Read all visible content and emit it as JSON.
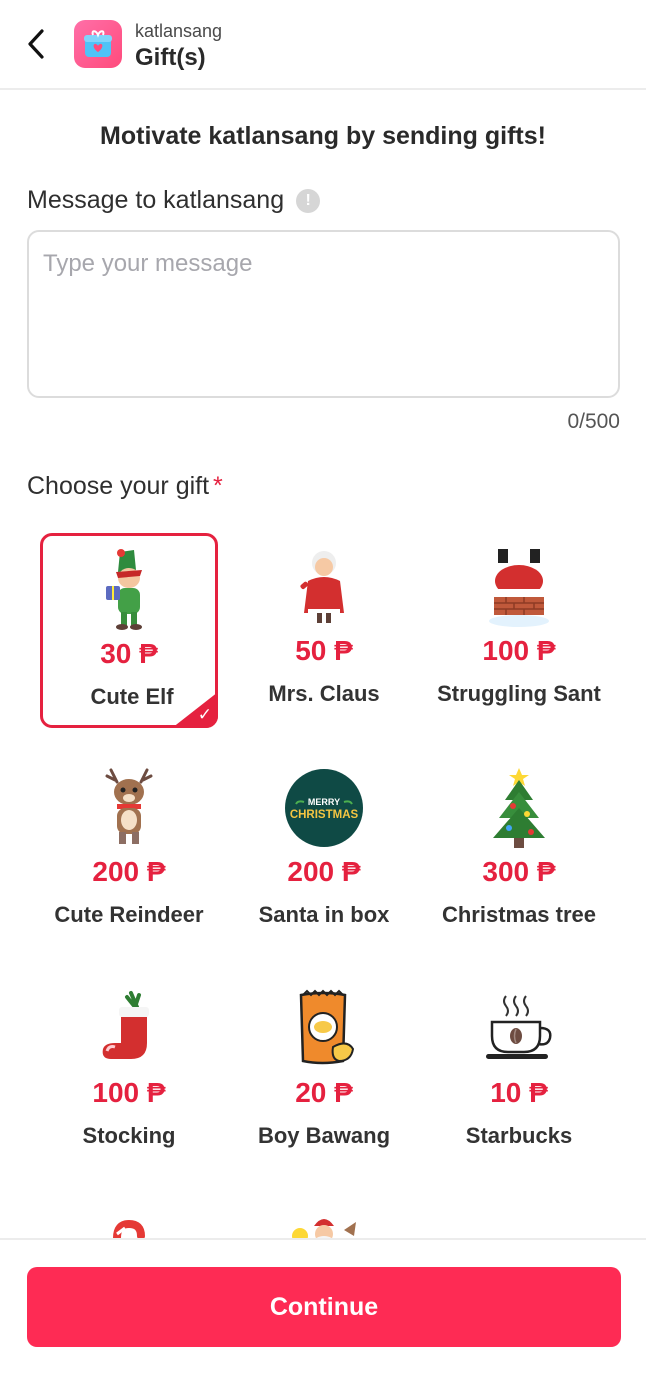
{
  "header": {
    "subtitle": "katlansang",
    "title": "Gift(s)"
  },
  "headline": "Motivate katlansang by sending gifts!",
  "message": {
    "label": "Message to katlansang",
    "placeholder": "Type your message",
    "value": "",
    "counter": "0/500"
  },
  "choose": {
    "label": "Choose your gift",
    "required_mark": "*"
  },
  "gifts": [
    {
      "price": "30 ₱",
      "name": "Cute Elf",
      "icon": "elf-icon",
      "selected": true
    },
    {
      "price": "50 ₱",
      "name": "Mrs. Claus",
      "icon": "mrs-claus-icon",
      "selected": false
    },
    {
      "price": "100 ₱",
      "name": "Struggling Sant",
      "icon": "struggling-santa-icon",
      "selected": false
    },
    {
      "price": "200 ₱",
      "name": "Cute Reindeer",
      "icon": "reindeer-icon",
      "selected": false
    },
    {
      "price": "200 ₱",
      "name": "Santa in box",
      "icon": "merry-christmas-badge-icon",
      "badge_text": "MERRY CHRISTMAS",
      "selected": false
    },
    {
      "price": "300 ₱",
      "name": "Christmas tree",
      "icon": "christmas-tree-icon",
      "selected": false
    },
    {
      "price": "100 ₱",
      "name": "Stocking",
      "icon": "stocking-icon",
      "selected": false
    },
    {
      "price": "20 ₱",
      "name": "Boy Bawang",
      "icon": "snack-bag-icon",
      "selected": false
    },
    {
      "price": "10 ₱",
      "name": "Starbucks",
      "icon": "coffee-cup-icon",
      "selected": false
    },
    {
      "price": "",
      "name": "",
      "icon": "candy-cane-icon",
      "selected": false
    },
    {
      "price": "",
      "name": "",
      "icon": "santa-sleigh-icon",
      "selected": false
    }
  ],
  "footer": {
    "continue_label": "Continue"
  },
  "colors": {
    "accent": "#e5213f",
    "button": "#fe2b54",
    "app_icon": "#ff4b7c"
  }
}
